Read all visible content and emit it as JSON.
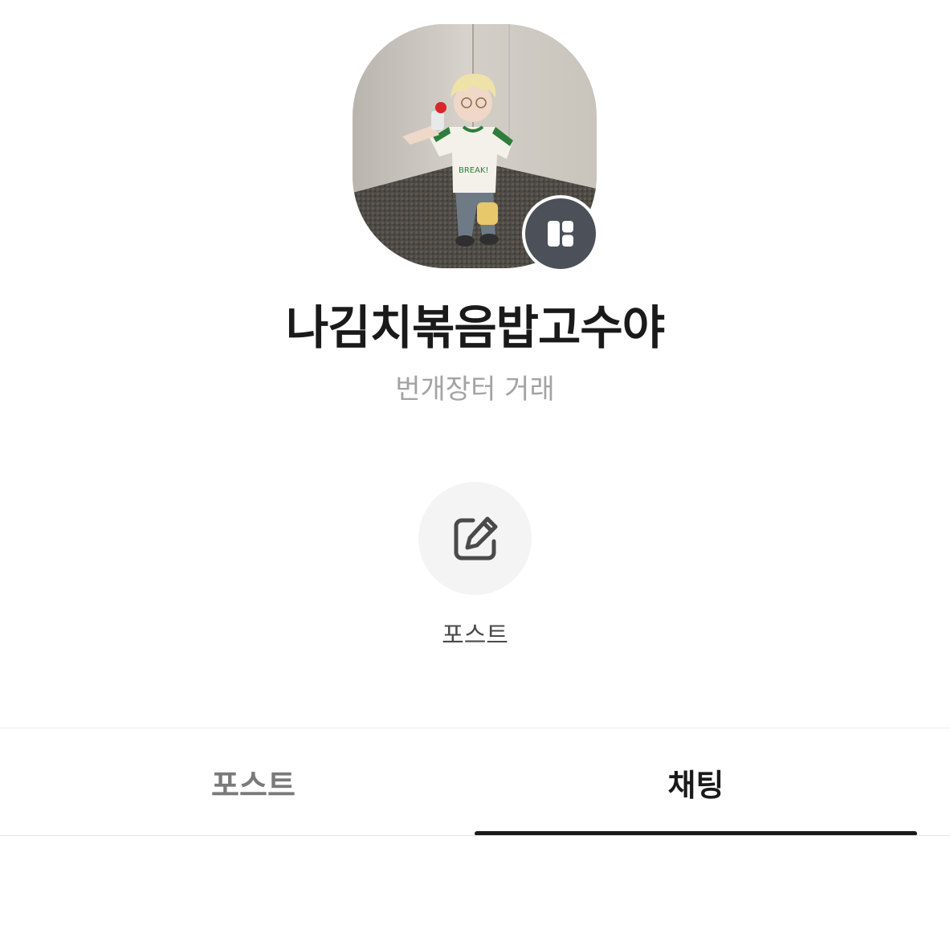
{
  "profile": {
    "name": "나김치볶음밥고수야",
    "subtitle": "번개장터 거래",
    "avatar_alt": "profile photo",
    "badge_icon": "layout-grid-icon"
  },
  "action": {
    "icon": "edit-icon",
    "label": "포스트"
  },
  "tabs": [
    {
      "label": "포스트",
      "active": false
    },
    {
      "label": "채팅",
      "active": true
    }
  ],
  "colors": {
    "badge_bg": "#4b5059",
    "active_tab": "#1a1a1a",
    "inactive_tab": "#7a7a7a",
    "subtitle": "#a3a3a3"
  }
}
